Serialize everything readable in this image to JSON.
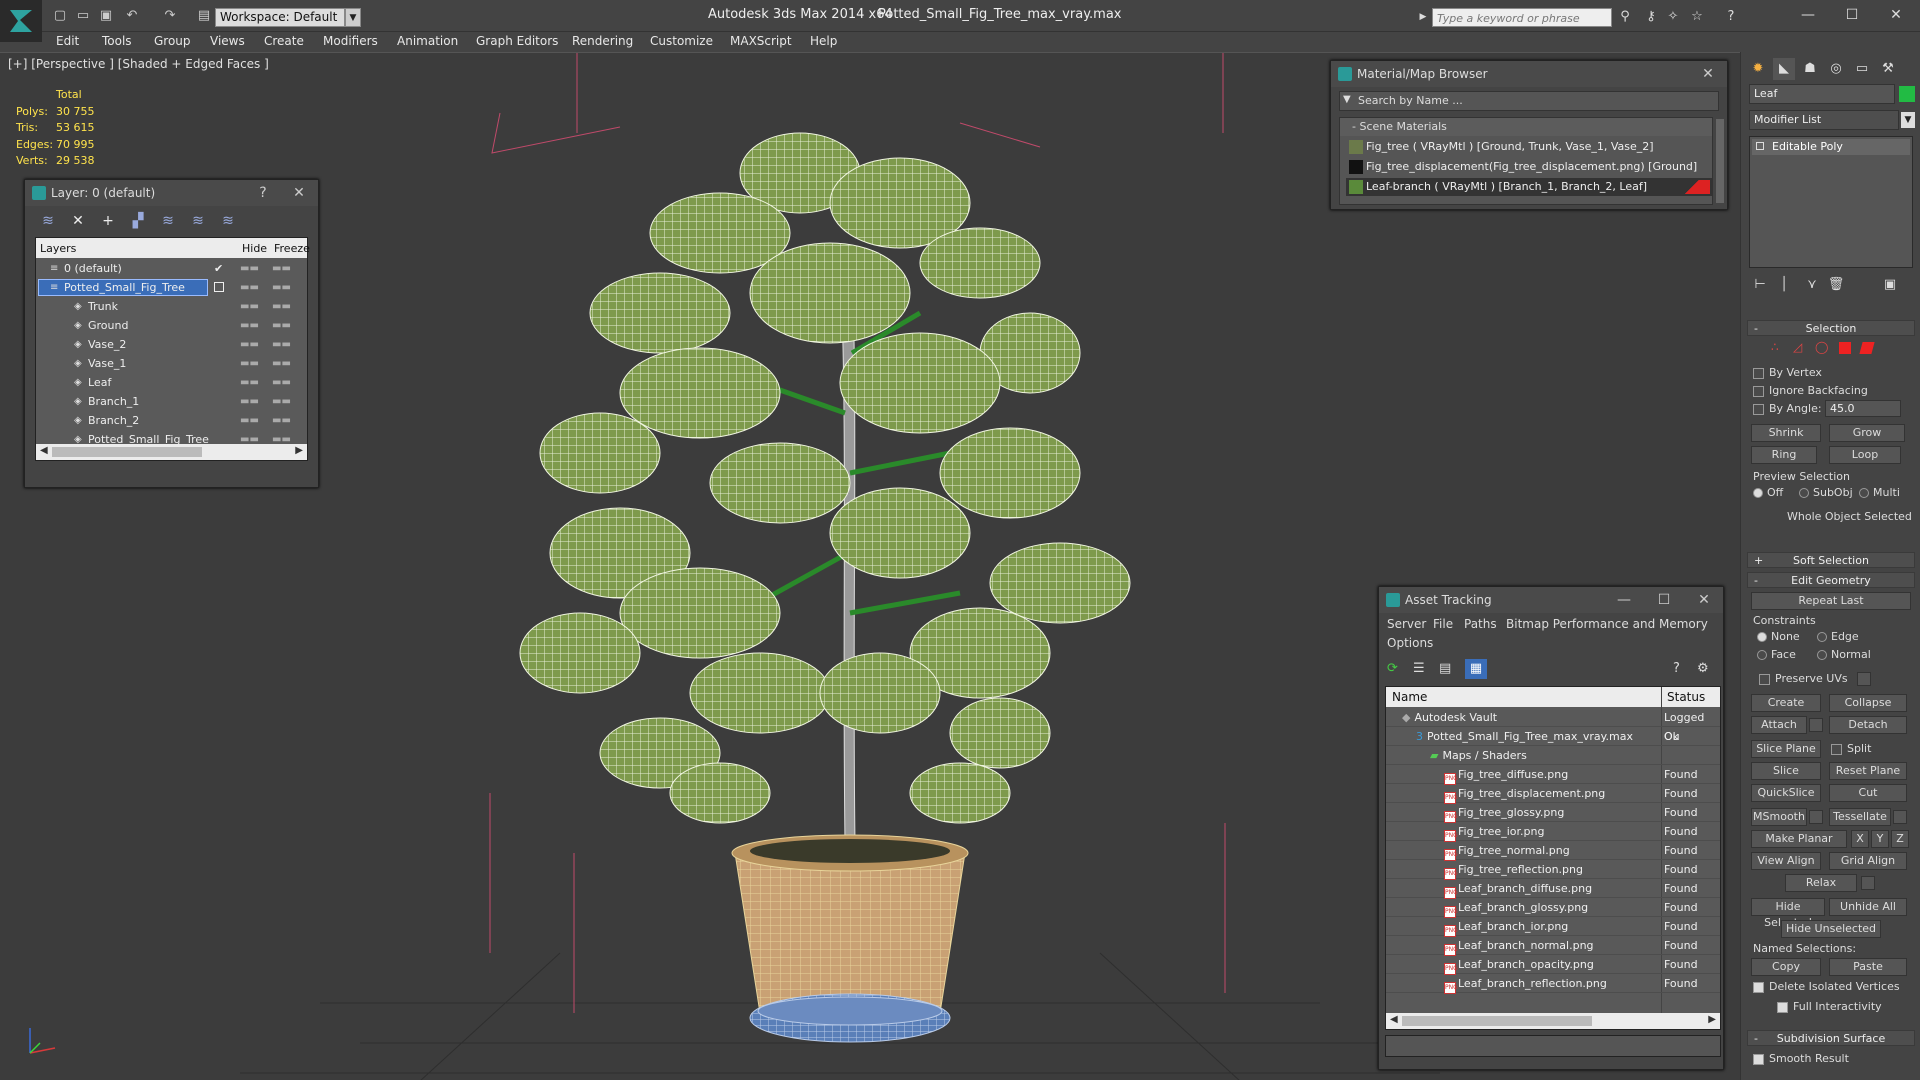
{
  "titlebar": {
    "workspace": "Workspace: Default",
    "app_title": "Autodesk 3ds Max  2014 x64",
    "file_title": "Potted_Small_Fig_Tree_max_vray.max",
    "search_placeholder": "Type a keyword or phrase"
  },
  "menu": [
    "Edit",
    "Tools",
    "Group",
    "Views",
    "Create",
    "Modifiers",
    "Animation",
    "Graph Editors",
    "Rendering",
    "Customize",
    "MAXScript",
    "Help"
  ],
  "viewport": {
    "label": "[+] [Perspective ] [Shaded + Edged Faces ]",
    "stats": {
      "total_label": "Total",
      "rows": [
        {
          "label": "Polys:",
          "value": "30 755"
        },
        {
          "label": "Tris:",
          "value": "53 615"
        },
        {
          "label": "Edges:",
          "value": "70 995"
        },
        {
          "label": "Verts:",
          "value": "29 538"
        }
      ]
    }
  },
  "layer_panel": {
    "title": "Layer: 0 (default)",
    "help": "?",
    "col_layers": "Layers",
    "col_hide": "Hide",
    "col_freeze": "Freeze",
    "rows": [
      {
        "name": "0 (default)",
        "indent": 0
      },
      {
        "name": "Potted_Small_Fig_Tree",
        "indent": 0,
        "selected": true
      },
      {
        "name": "Trunk",
        "indent": 1
      },
      {
        "name": "Ground",
        "indent": 1
      },
      {
        "name": "Vase_2",
        "indent": 1
      },
      {
        "name": "Vase_1",
        "indent": 1
      },
      {
        "name": "Leaf",
        "indent": 1
      },
      {
        "name": "Branch_1",
        "indent": 1
      },
      {
        "name": "Branch_2",
        "indent": 1
      },
      {
        "name": "Potted_Small_Fig_Tree",
        "indent": 1
      }
    ]
  },
  "material_browser": {
    "title": "Material/Map Browser",
    "search_placeholder": "Search by Name ...",
    "group": "- Scene Materials",
    "items": [
      {
        "label": "Fig_tree  ( VRayMtl )  [Ground, Trunk, Vase_1, Vase_2]",
        "swatch": "#6b7a4a"
      },
      {
        "label": "Fig_tree_displacement(Fig_tree_displacement.png) [Ground]",
        "swatch": "#111111"
      },
      {
        "label": "Leaf-branch  ( VRayMtl )  [Branch_1, Branch_2, Leaf]",
        "swatch": "#5a8a3a",
        "selected": true
      }
    ]
  },
  "asset_tracking": {
    "title": "Asset Tracking",
    "menu": [
      "Server",
      "File",
      "Paths",
      "Bitmap Performance and Memory"
    ],
    "options": "Options",
    "col_name": "Name",
    "col_status": "Status",
    "rows": [
      {
        "name": "Autodesk Vault",
        "status": "Logged Ou",
        "indent": 1,
        "icon": "vault"
      },
      {
        "name": "Potted_Small_Fig_Tree_max_vray.max",
        "status": "Ok",
        "indent": 2,
        "icon": "max"
      },
      {
        "name": "Maps / Shaders",
        "status": "",
        "indent": 3,
        "icon": "maps"
      },
      {
        "name": "Fig_tree_diffuse.png",
        "status": "Found",
        "indent": 4,
        "icon": "png"
      },
      {
        "name": "Fig_tree_displacement.png",
        "status": "Found",
        "indent": 4,
        "icon": "png"
      },
      {
        "name": "Fig_tree_glossy.png",
        "status": "Found",
        "indent": 4,
        "icon": "png"
      },
      {
        "name": "Fig_tree_ior.png",
        "status": "Found",
        "indent": 4,
        "icon": "png"
      },
      {
        "name": "Fig_tree_normal.png",
        "status": "Found",
        "indent": 4,
        "icon": "png"
      },
      {
        "name": "Fig_tree_reflection.png",
        "status": "Found",
        "indent": 4,
        "icon": "png"
      },
      {
        "name": "Leaf_branch_diffuse.png",
        "status": "Found",
        "indent": 4,
        "icon": "png"
      },
      {
        "name": "Leaf_branch_glossy.png",
        "status": "Found",
        "indent": 4,
        "icon": "png"
      },
      {
        "name": "Leaf_branch_ior.png",
        "status": "Found",
        "indent": 4,
        "icon": "png"
      },
      {
        "name": "Leaf_branch_normal.png",
        "status": "Found",
        "indent": 4,
        "icon": "png"
      },
      {
        "name": "Leaf_branch_opacity.png",
        "status": "Found",
        "indent": 4,
        "icon": "png"
      },
      {
        "name": "Leaf_branch_reflection.png",
        "status": "Found",
        "indent": 4,
        "icon": "png"
      }
    ]
  },
  "command_panel": {
    "object_name": "Leaf",
    "object_color": "#22bb44",
    "modifier_list": "Modifier List",
    "stack_item": "Editable Poly",
    "selection": {
      "title": "Selection",
      "by_vertex": "By Vertex",
      "ignore_backfacing": "Ignore Backfacing",
      "by_angle": "By Angle:",
      "angle_value": "45.0",
      "shrink": "Shrink",
      "grow": "Grow",
      "ring": "Ring",
      "loop": "Loop",
      "preview_selection": "Preview Selection",
      "off": "Off",
      "subobj": "SubObj",
      "multi": "Multi",
      "whole_object": "Whole Object Selected"
    },
    "soft_selection": "Soft Selection",
    "edit_geometry": {
      "title": "Edit Geometry",
      "repeat_last": "Repeat Last",
      "constraints": "Constraints",
      "none": "None",
      "edge": "Edge",
      "face": "Face",
      "normal": "Normal",
      "preserve_uvs": "Preserve UVs",
      "create": "Create",
      "collapse": "Collapse",
      "attach": "Attach",
      "detach": "Detach",
      "slice_plane": "Slice Plane",
      "split": "Split",
      "slice": "Slice",
      "reset_plane": "Reset Plane",
      "quickslice": "QuickSlice",
      "cut": "Cut",
      "msmooth": "MSmooth",
      "tessellate": "Tessellate",
      "make_planar": "Make Planar",
      "x": "X",
      "y": "Y",
      "z": "Z",
      "view_align": "View Align",
      "grid_align": "Grid Align",
      "relax": "Relax",
      "hide_selected": "Hide Selected",
      "unhide_all": "Unhide All",
      "hide_unselected": "Hide Unselected",
      "named_selections": "Named Selections:",
      "copy": "Copy",
      "paste": "Paste",
      "delete_isolated": "Delete Isolated Vertices",
      "full_interactivity": "Full Interactivity"
    },
    "subdivision_surface": "Subdivision Surface",
    "smooth_result": "Smooth Result"
  }
}
